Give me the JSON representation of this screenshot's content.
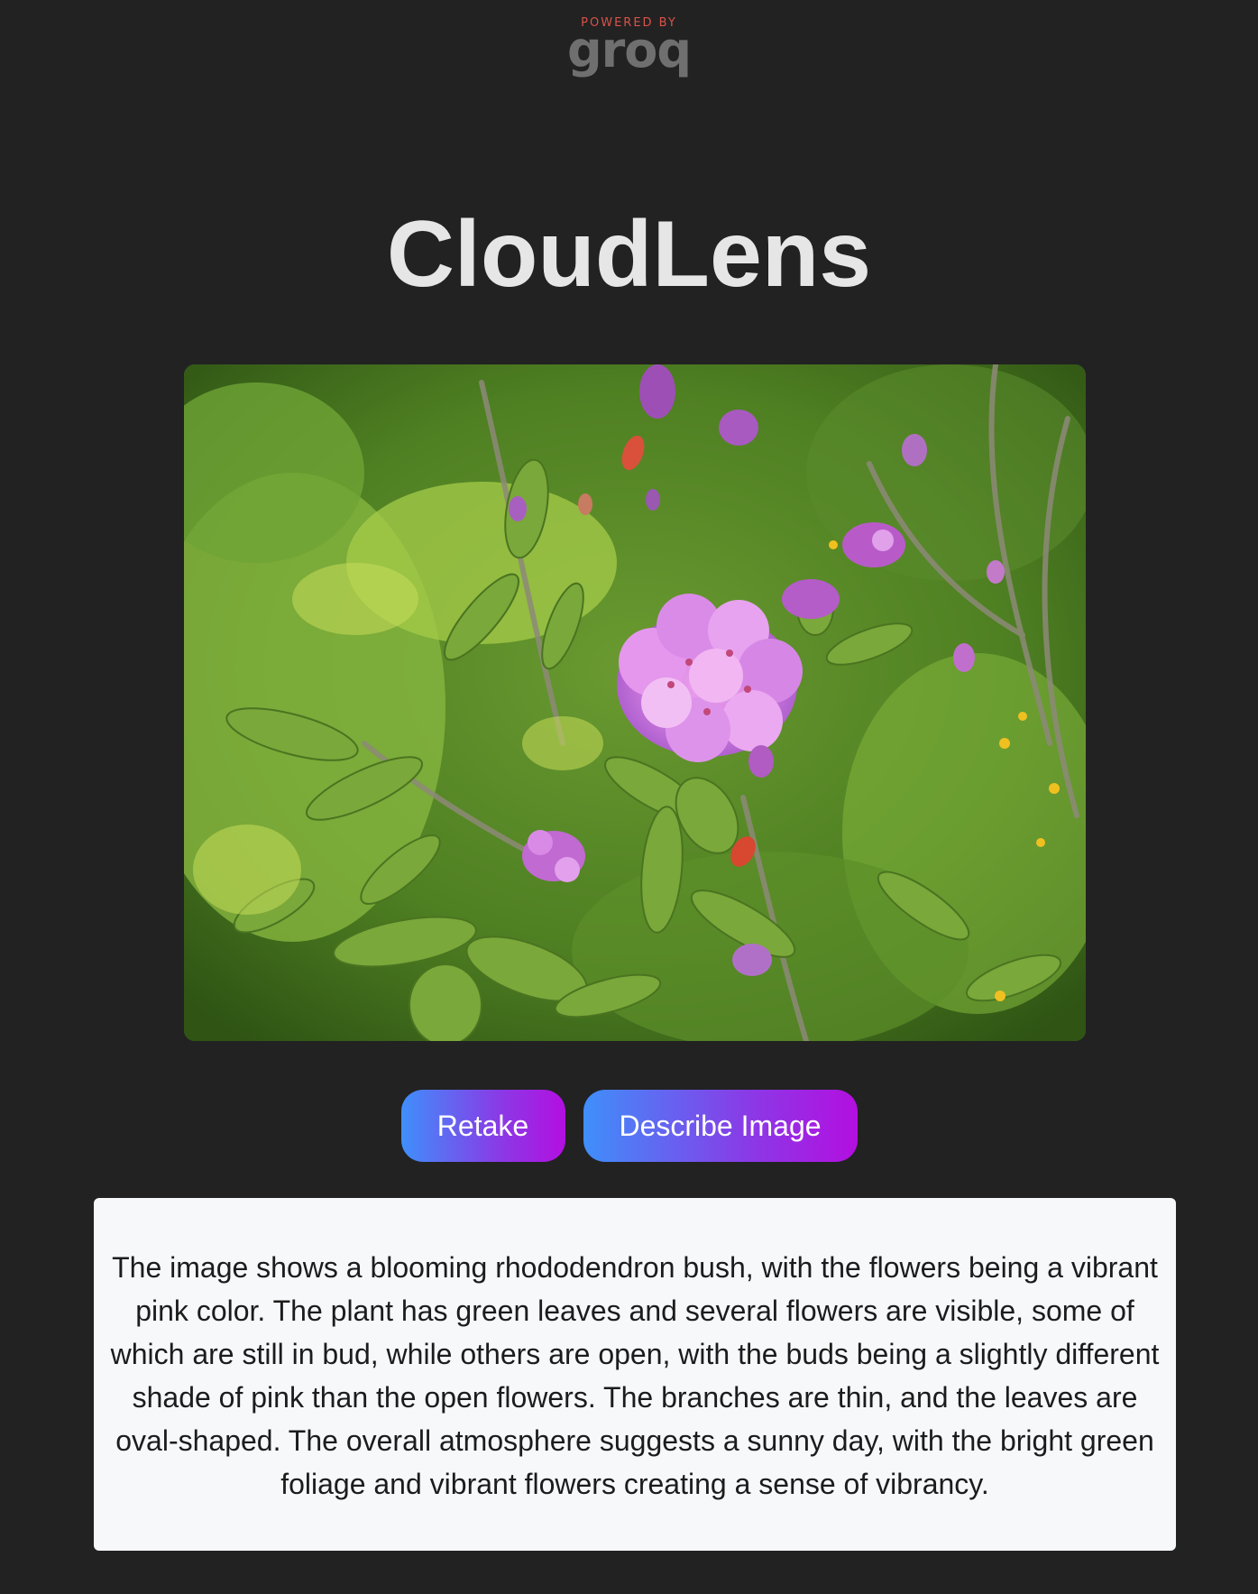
{
  "branding": {
    "powered_by": "POWERED BY",
    "logo_text": "groq"
  },
  "app": {
    "title": "CloudLens"
  },
  "photo": {
    "subject": "blooming rhododendron bush with pink flowers and green leaves"
  },
  "actions": {
    "retake_label": "Retake",
    "describe_label": "Describe Image"
  },
  "description": {
    "text": "The image shows a blooming rhododendron bush, with the flowers being a vibrant pink color. The plant has green leaves and several flowers are visible, some of which are still in bud, while others are open, with the buds being a slightly different shade of pink than the open flowers. The branches are thin, and the leaves are oval-shaped. The overall atmosphere suggests a sunny day, with the bright green foliage and vibrant flowers creating a sense of vibrancy."
  },
  "colors": {
    "background": "#222222",
    "title": "#e6e6e6",
    "button_gradient_start": "#3f8ffb",
    "button_gradient_end": "#b30fe0",
    "description_bg": "#f7f8fa",
    "powered_by": "#d9534a",
    "logo": "#6f6f6f"
  }
}
